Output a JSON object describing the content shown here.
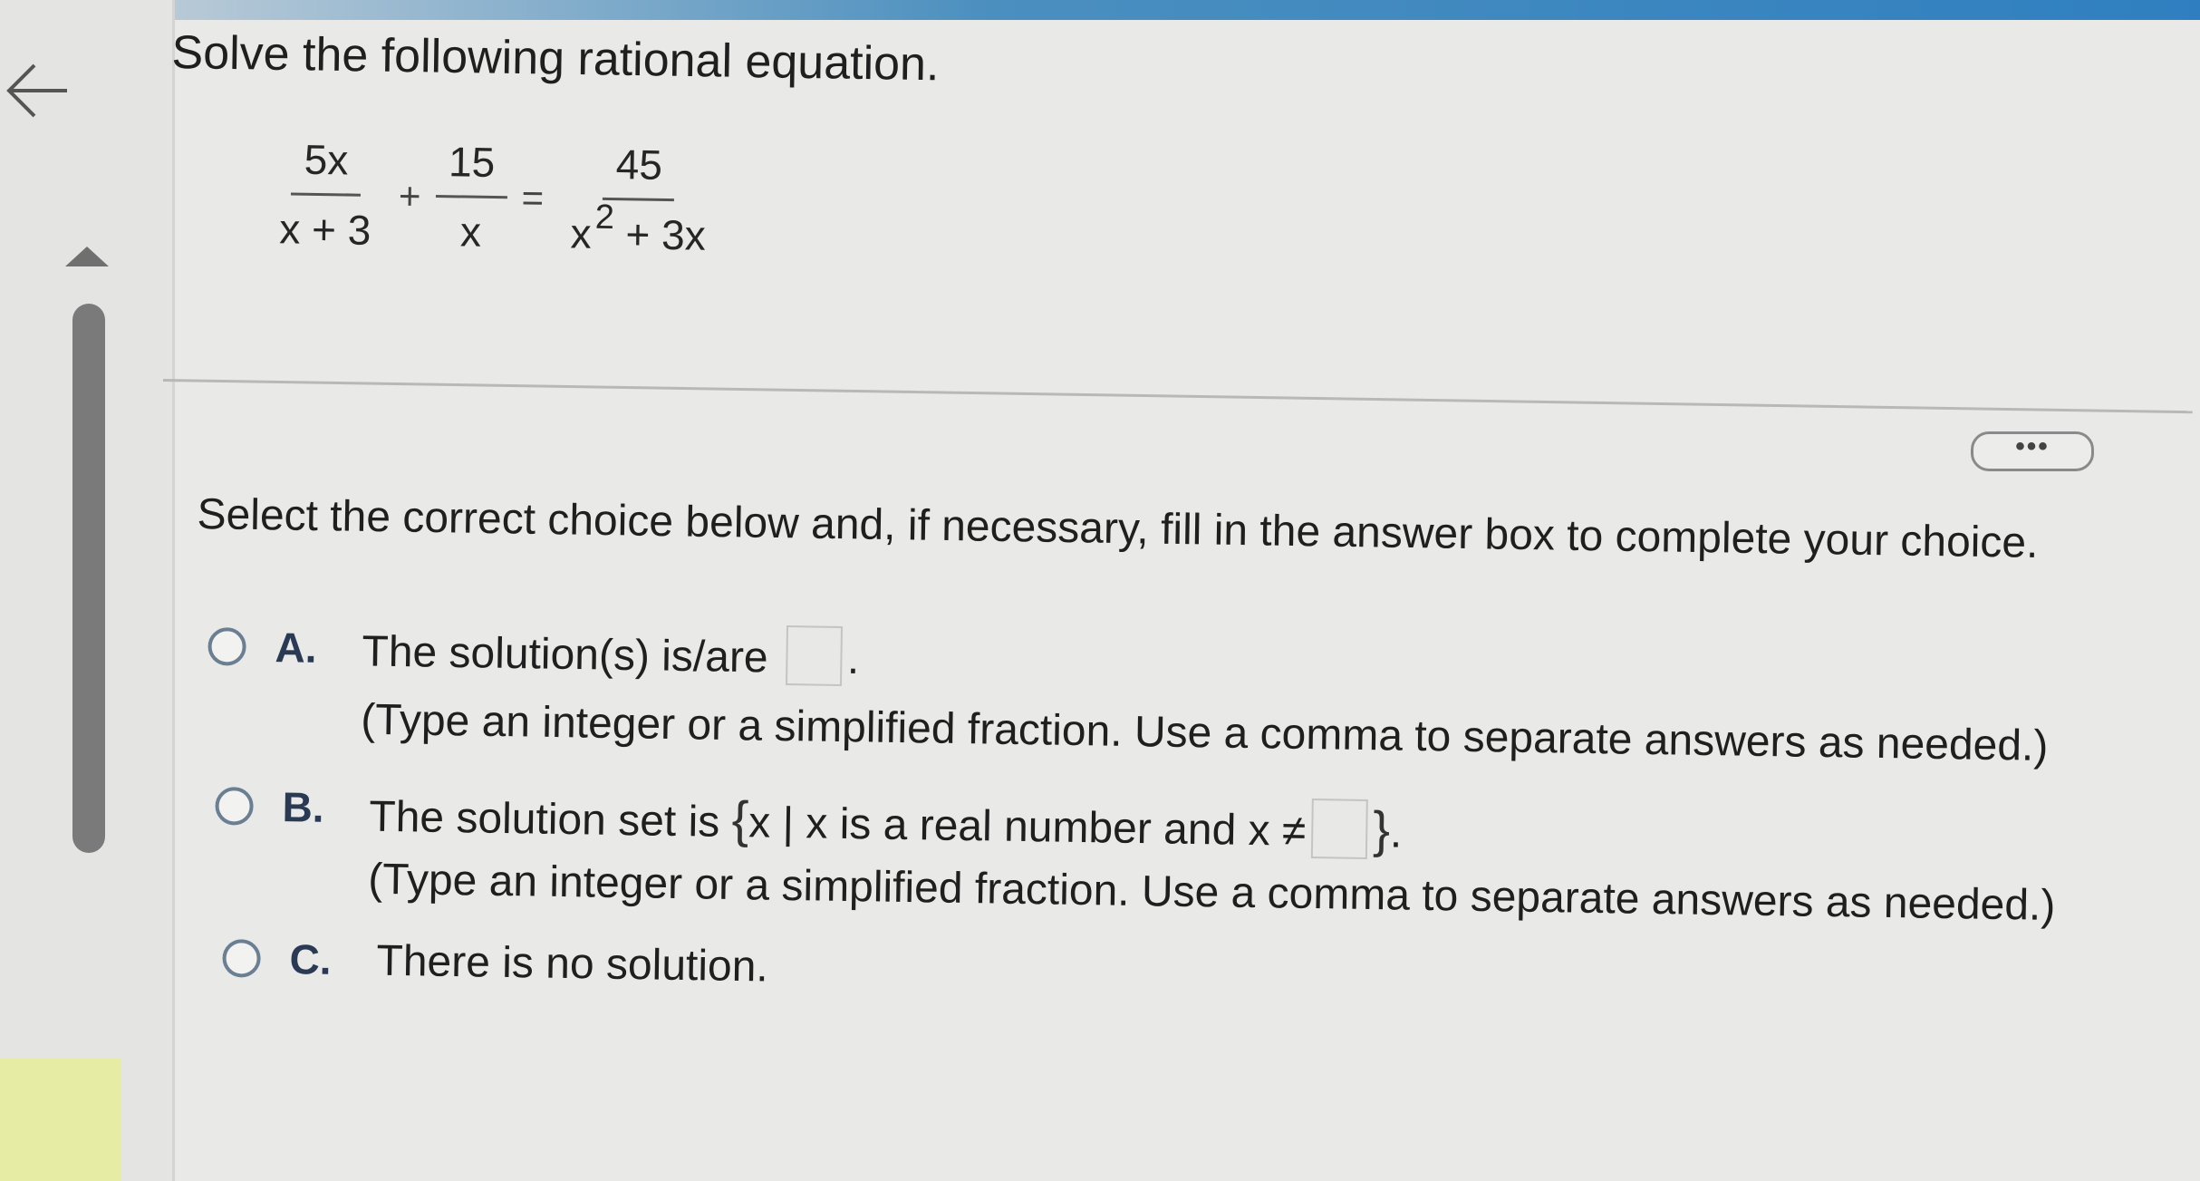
{
  "question": {
    "title": "Solve the following rational equation."
  },
  "equation": {
    "left_num": "5x",
    "left_den": "x + 3",
    "plus": "+",
    "mid_num": "15",
    "mid_den": "x",
    "equals": "=",
    "right_num": "45",
    "right_den_base": "x",
    "right_den_exp": "2",
    "right_den_rest": "+ 3x"
  },
  "more_button": {
    "label": "•••"
  },
  "instruction": "Select the correct choice below and, if necessary, fill in the answer box to complete your choice.",
  "choices": [
    {
      "letter": "A.",
      "text": "The solution(s) is/are",
      "text_after": ".",
      "hint": "(Type an integer or a simplified fraction. Use a comma to separate answers as needed.)"
    },
    {
      "letter": "B.",
      "text_open": "The solution set is",
      "brace_open": "{",
      "text_inner": "x | x is a real number and x ≠",
      "brace_close": "}",
      "text_after": ".",
      "hint": "(Type an integer or a simplified fraction. Use a comma to separate answers as needed.)"
    },
    {
      "letter": "C.",
      "text": "There is no solution."
    }
  ],
  "icons": {
    "back": "arrow-left-icon",
    "scroll_up": "triangle-up-icon"
  },
  "colors": {
    "radio_border": "#6b7f93",
    "letter": "#2a3a55",
    "top_bar": "#2f7fc0",
    "corner": "#e7eca5"
  }
}
